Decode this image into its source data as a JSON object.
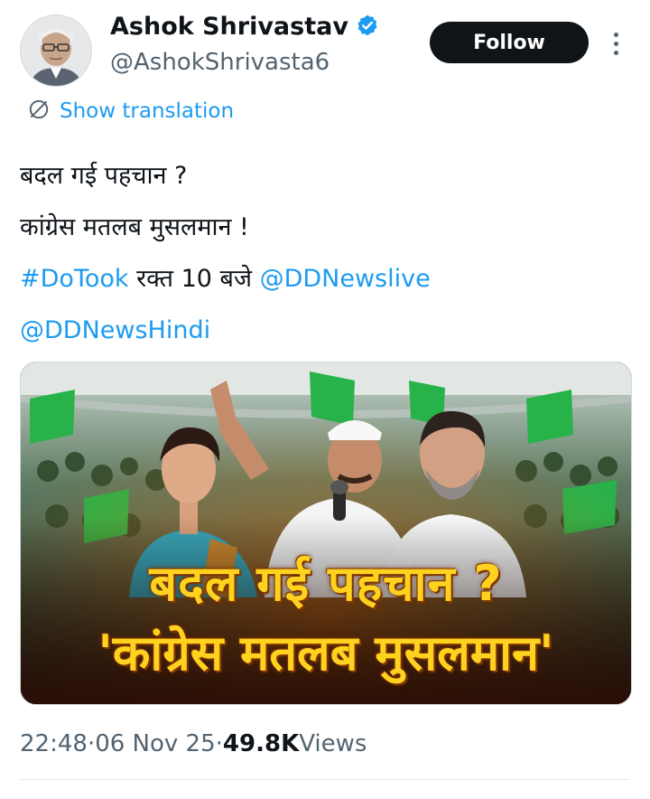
{
  "author": {
    "name": "Ashok Shrivastav",
    "handle": "@AshokShrivasta6",
    "verified": true,
    "verified_color": "#1d9bf0"
  },
  "actions": {
    "follow_label": "Follow",
    "more_icon": "more-vertical-icon"
  },
  "translation": {
    "label": "Show translation",
    "icon": "translate-globe-icon"
  },
  "tweet": {
    "line1": "बदल गई पहचान ?",
    "line2": "कांग्रेस मतलब मुसलमान !",
    "hashtag": "#DoTook",
    "line3_mid": " रक्त 10 बजे ",
    "mention1": "@DDNewslive",
    "mention2": "@DDNewsHindi",
    "link_color": "#1d9bf0"
  },
  "media": {
    "headline_line1": "बदल गई पहचान ?",
    "headline_line2": "'कांग्रेस मतलब मुसलमान'",
    "headline_color": "#ffd21f"
  },
  "meta": {
    "time": "22:48",
    "sep1": " · ",
    "date": "06 Nov 25",
    "sep2": " · ",
    "views_count": "49.8K",
    "views_label": " Views"
  }
}
